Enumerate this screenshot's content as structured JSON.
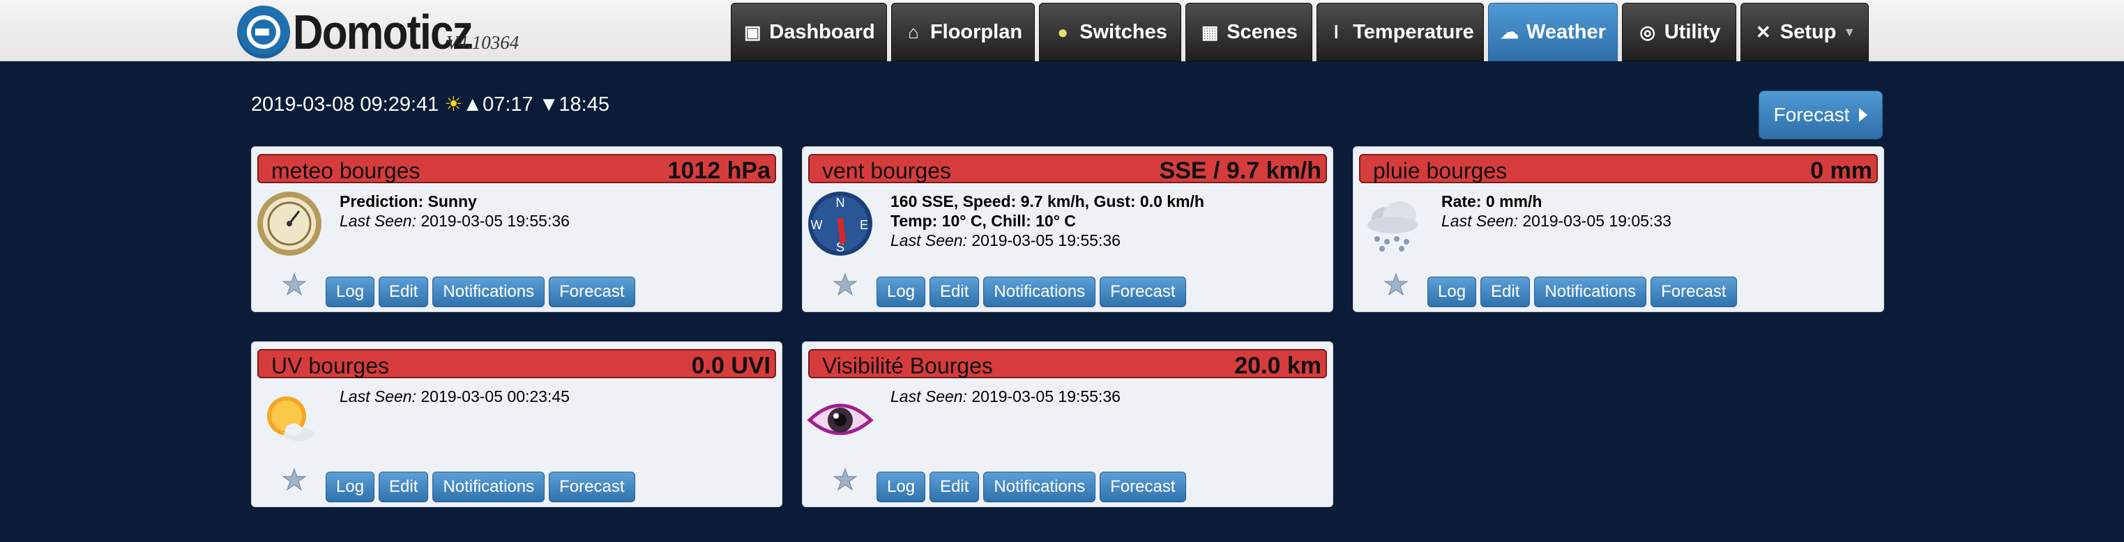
{
  "app": {
    "name": "Domoticz",
    "version": "V4.10364"
  },
  "nav": [
    {
      "label": "Dashboard",
      "icon": "dashboard-icon"
    },
    {
      "label": "Floorplan",
      "icon": "floorplan-icon"
    },
    {
      "label": "Switches",
      "icon": "lightbulb-icon"
    },
    {
      "label": "Scenes",
      "icon": "scenes-icon"
    },
    {
      "label": "Temperature",
      "icon": "thermometer-icon"
    },
    {
      "label": "Weather",
      "icon": "cloud-icon",
      "active": true
    },
    {
      "label": "Utility",
      "icon": "utility-icon"
    },
    {
      "label": "Setup",
      "icon": "tools-icon"
    }
  ],
  "header": {
    "datetime": "2019-03-08 09:29:41",
    "sunrise": "07:17",
    "sunset": "18:45",
    "forecast_label": "Forecast"
  },
  "buttons": {
    "log": "Log",
    "edit": "Edit",
    "notifications": "Notifications",
    "forecast": "Forecast"
  },
  "last_seen_label": "Last Seen:",
  "colors": {
    "header_red": "#d73c3c",
    "button_blue": "#2f72ad",
    "background": "#0a1c38"
  },
  "devices": [
    {
      "name": "meteo bourges",
      "value": "1012 hPa",
      "icon": "barometer-icon",
      "line1": "Prediction: Sunny",
      "line2": "",
      "last_seen": "2019-03-05 19:55:36"
    },
    {
      "name": "vent bourges",
      "value": "SSE / 9.7 km/h",
      "icon": "compass-icon",
      "line1": "160 SSE, Speed: 9.7 km/h, Gust: 0.0 km/h",
      "line2": "Temp: 10° C, Chill: 10° C",
      "last_seen": "2019-03-05 19:55:36"
    },
    {
      "name": "pluie bourges",
      "value": "0 mm",
      "icon": "rain-icon",
      "line1": "Rate: 0 mm/h",
      "line2": "",
      "last_seen": "2019-03-05 19:05:33"
    },
    {
      "name": "UV bourges",
      "value": "0.0 UVI",
      "icon": "uv-sun-icon",
      "line1": "",
      "line2": "",
      "last_seen": "2019-03-05 00:23:45"
    },
    {
      "name": "Visibilité Bourges",
      "value": "20.0 km",
      "icon": "eye-icon",
      "line1": "",
      "line2": "",
      "last_seen": "2019-03-05 19:55:36"
    }
  ]
}
